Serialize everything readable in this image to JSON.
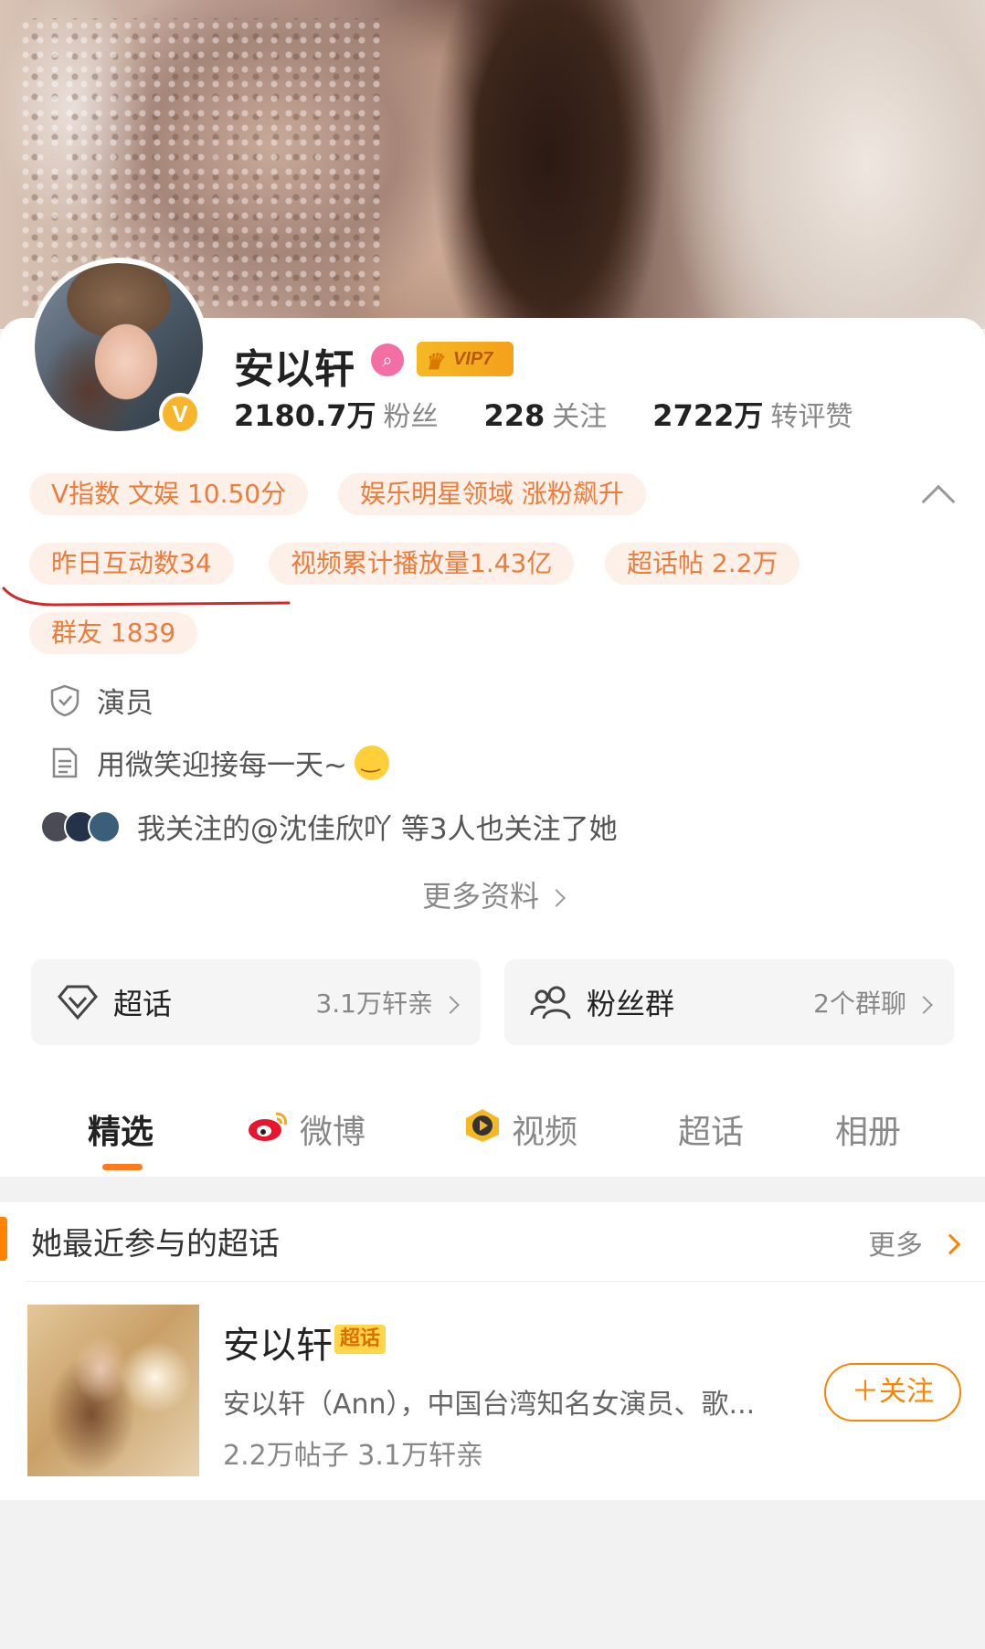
{
  "profile": {
    "name": "安以轩",
    "vip_label": "VIP7",
    "stats": [
      {
        "value": "2180.7万",
        "label": "粉丝"
      },
      {
        "value": "228",
        "label": "关注"
      },
      {
        "value": "2722万",
        "label": "转评赞"
      }
    ],
    "tags": [
      "V指数 文娱 10.50分",
      "娱乐明星领域 涨粉飙升",
      "昨日互动数34",
      "视频累计播放量1.43亿",
      "超话帖 2.2万",
      "群友 1839"
    ],
    "occupation": "演员",
    "bio": "用微笑迎接每一天~",
    "mutual_follow": "我关注的@沈佳欣吖 等3人也关注了她",
    "more_info": "更多资料"
  },
  "boxes": {
    "supertopic": {
      "title": "超话",
      "detail": "3.1万轩亲"
    },
    "fan_group": {
      "title": "粉丝群",
      "detail": "2个群聊"
    }
  },
  "tabs": [
    "精选",
    "微博",
    "视频",
    "超话",
    "相册"
  ],
  "section": {
    "title": "她最近参与的超话",
    "more": "更多",
    "topic": {
      "name": "安以轩",
      "badge": "超话",
      "desc": "安以轩（Ann），中国台湾知名女演员、歌...",
      "meta": "2.2万帖子 3.1万轩亲",
      "follow_label": "关注"
    }
  },
  "colors": {
    "accent": "#ff8200",
    "tag_text": "#f07a3a",
    "tag_bg": "#fdf0e8",
    "vip": "#f5b825"
  }
}
